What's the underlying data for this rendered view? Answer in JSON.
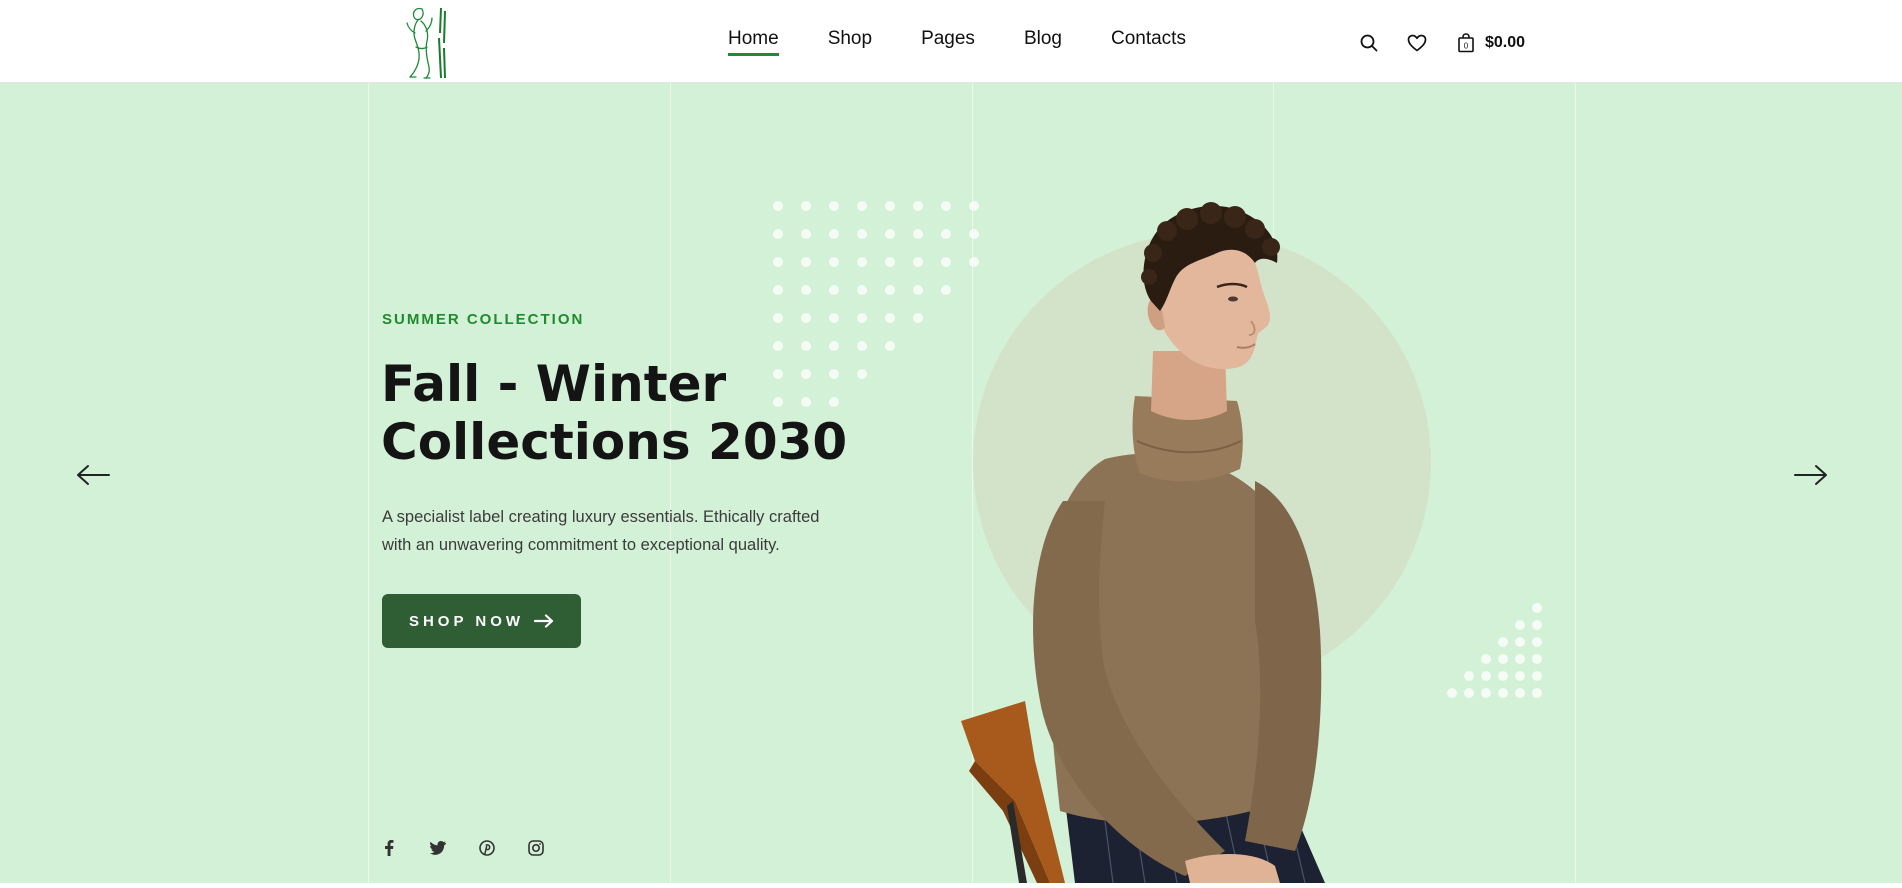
{
  "header": {
    "logo": {
      "name": "brand-logo",
      "icon": "figure-logo-icon"
    },
    "nav": [
      {
        "label": "Home",
        "active": true
      },
      {
        "label": "Shop",
        "active": false
      },
      {
        "label": "Pages",
        "active": false
      },
      {
        "label": "Blog",
        "active": false
      },
      {
        "label": "Contacts",
        "active": false
      }
    ],
    "tools": {
      "search_icon": "search-icon",
      "wishlist_icon": "heart-icon",
      "cart_icon": "shopping-bag-icon",
      "cart_count": "0",
      "cart_total": "$0.00"
    }
  },
  "hero": {
    "subtitle": "SUMMER COLLECTION",
    "title_line1": "Fall - Winter",
    "title_line2": "Collections 2030",
    "description_line1": "A specialist label creating luxury essentials. Ethically crafted",
    "description_line2": "with an unwavering commitment to exceptional quality.",
    "cta_label": "SHOP NOW",
    "prev_icon": "arrow-left-icon",
    "next_icon": "arrow-right-icon",
    "socials": [
      "facebook-icon",
      "twitter-icon",
      "pinterest-icon",
      "instagram-icon"
    ]
  },
  "colors": {
    "hero_bg": "#d3f1d6",
    "accent_green": "#1f8b2c",
    "button_bg": "#2f5e35",
    "nav_underline": "#1e8a3a",
    "circle": "#d3e3c9"
  }
}
